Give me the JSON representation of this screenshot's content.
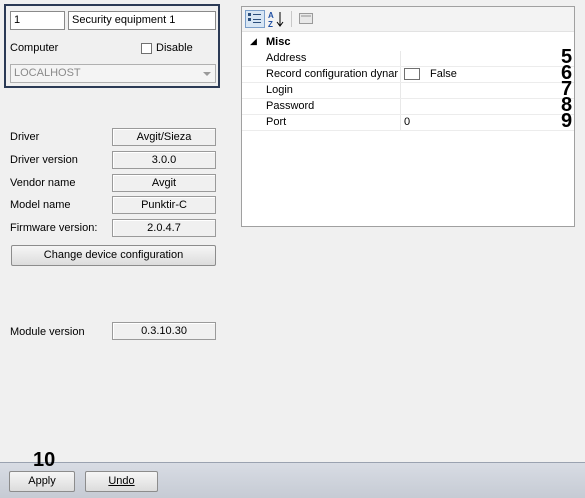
{
  "object": {
    "id": "1",
    "name": "Security equipment 1",
    "computer_label": "Computer",
    "disable_label": "Disable",
    "disable_checked": false,
    "computer_value": "LOCALHOST"
  },
  "info": {
    "driver_label": "Driver",
    "driver_value": "Avgit/Sieza",
    "driver_version_label": "Driver version",
    "driver_version_value": "3.0.0",
    "vendor_label": "Vendor name",
    "vendor_value": "Avgit",
    "model_label": "Model name",
    "model_value": "Punktir-C",
    "firmware_label": "Firmware version:",
    "firmware_value": "2.0.4.7",
    "change_button": "Change device configuration",
    "module_label": "Module version",
    "module_value": "0.3.10.30"
  },
  "propgrid": {
    "category": "Misc",
    "rows": [
      {
        "name": "Address",
        "value": "",
        "callout": "5"
      },
      {
        "name": "Record configuration dynar",
        "value": "False",
        "callout": "6"
      },
      {
        "name": "Login",
        "value": "",
        "callout": "7"
      },
      {
        "name": "Password",
        "value": "",
        "callout": "8"
      },
      {
        "name": "Port",
        "value": "0",
        "callout": "9"
      }
    ]
  },
  "footer": {
    "callout": "10",
    "apply_label": "Apply",
    "undo_label": "Undo"
  }
}
